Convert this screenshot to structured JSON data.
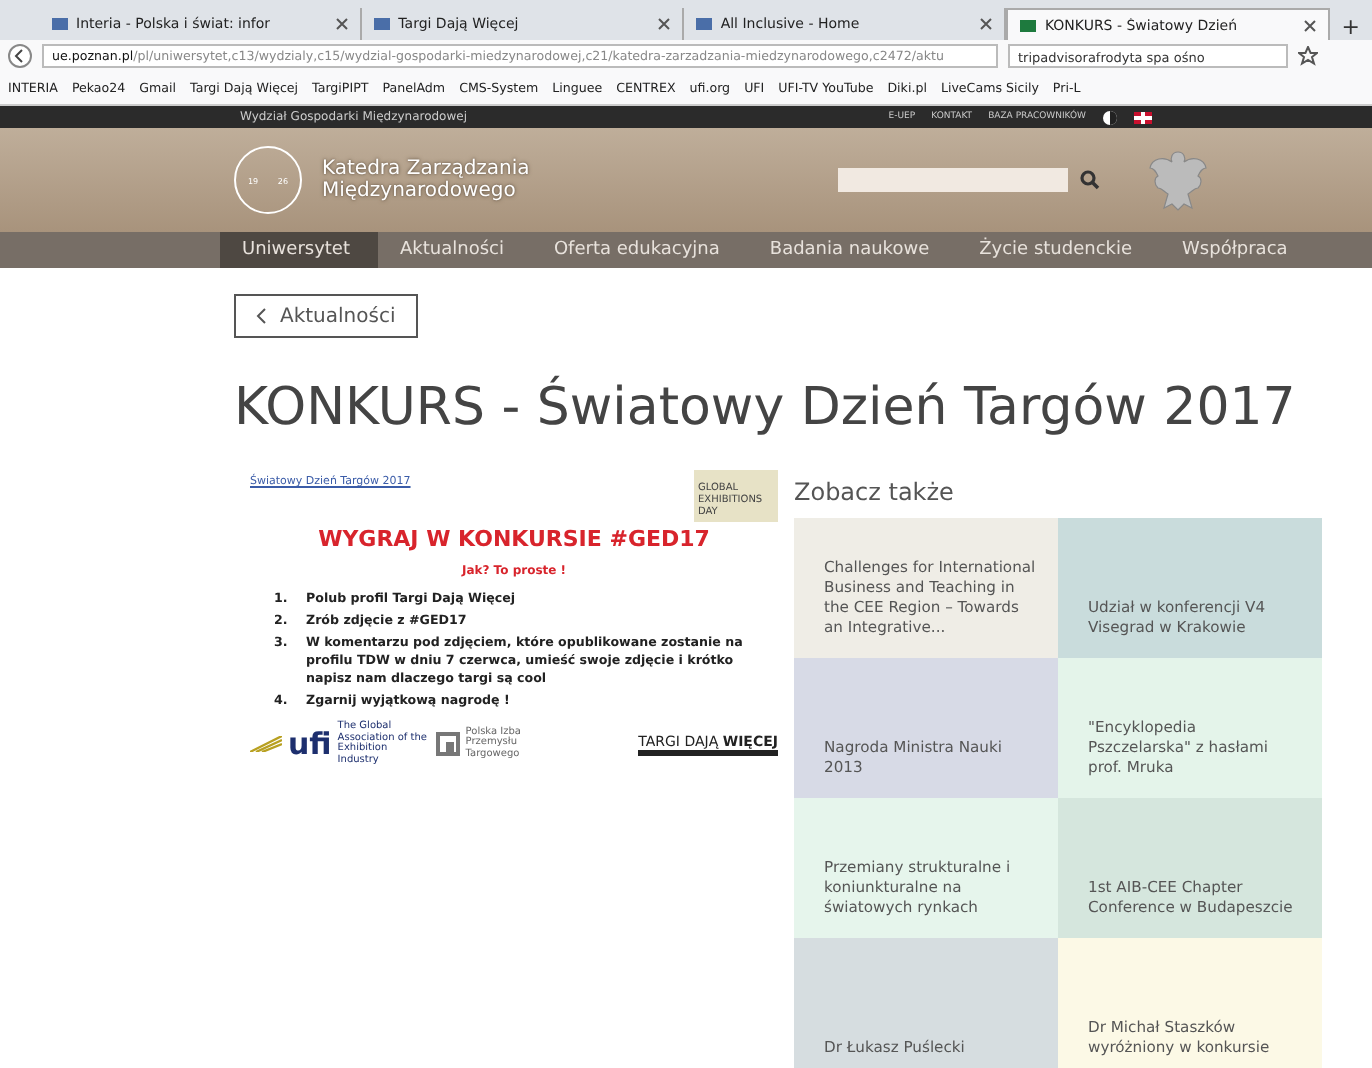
{
  "browser": {
    "tabs": [
      {
        "label": "Interia - Polska i świat: infor",
        "selected": false
      },
      {
        "label": "Targi Dają Więcej",
        "selected": false
      },
      {
        "label": "All Inclusive - Home",
        "selected": false
      },
      {
        "label": "KONKURS - Światowy Dzień",
        "selected": true
      }
    ],
    "new_tab": "+",
    "url": {
      "host": "ue.poznan.pl",
      "path": "/pl/uniwersytet,c13/wydzialy,c15/wydzial-gospodarki-miedzynarodowej,c21/katedra-zarzadzania-miedzynarodowego,c2472/aktu"
    },
    "search": {
      "value": "tripadvisorafrodyta spa ośno"
    },
    "bookmarks": [
      "INTERIA",
      "Pekao24",
      "Gmail",
      "Targi Dają Więcej",
      "TargiPIPT",
      "PanelAdm",
      "CMS-System",
      "Linguee",
      "CENTREX",
      "ufi.org",
      "UFI",
      "UFI-TV YouTube",
      "Diki.pl",
      "LiveCams Sicily",
      "Pri-L"
    ]
  },
  "topbar": {
    "faculty": "Wydział Gospodarki Międzynarodowej",
    "links": [
      "E-UEP",
      "KONTAKT",
      "BAZA PRACOWNIKÓW"
    ]
  },
  "header": {
    "title_line1": "Katedra Zarządzania",
    "title_line2": "Międzynarodowego",
    "logo_years": [
      "19",
      "26"
    ]
  },
  "nav": [
    {
      "label": "Uniwersytet",
      "selected": true
    },
    {
      "label": "Aktualności",
      "selected": false
    },
    {
      "label": "Oferta edukacyjna",
      "selected": false
    },
    {
      "label": "Badania naukowe",
      "selected": false
    },
    {
      "label": "Życie studenckie",
      "selected": false
    },
    {
      "label": "Współpraca",
      "selected": false
    }
  ],
  "back_button": "Aktualności",
  "page_title": "KONKURS - Światowy Dzień Targów 2017",
  "slide": {
    "caption": "Światowy Dzień Targów 2017",
    "badge": "GLOBAL EXHIBITIONS DAY",
    "headline": "WYGRAJ W KONKURSIE #GED17",
    "subhead": "Jak? To proste !",
    "steps": [
      {
        "number": "1.",
        "text": "Polub profil Targi Dają Więcej"
      },
      {
        "number": "2.",
        "text": "Zrób zdjęcie z #GED17"
      },
      {
        "number": "3.",
        "text": "W komentarzu pod zdjęciem, które opublikowane zostanie na profilu TDW w dniu 7 czerwca, umieść swoje zdjęcie i krótko napisz nam dlaczego targi są cool"
      },
      {
        "number": "4.",
        "text": "Zgarnij wyjątkową nagrodę !"
      }
    ],
    "ufi": "ufi",
    "ufi_tagline": "The Global Association of the Exhibition Industry",
    "pipt": "Polska Izba Przemysłu Targowego",
    "tdw": "TARGI DAJĄ **WIĘCEJ**"
  },
  "see_also": {
    "heading": "Zobacz także",
    "tiles": [
      {
        "title": "Challenges for International Business and Teaching in the CEE Region – Towards an Integrative...",
        "color": "#efede6"
      },
      {
        "title": "Udział w konferencji V4 Visegrad w Krakowie",
        "color": "#c9dcdc"
      },
      {
        "title": "Nagroda Ministra Nauki 2013",
        "color": "#d7dae6"
      },
      {
        "title": "\"Encyklopedia Pszczelarska\" z hasłami prof. Mruka",
        "color": "#e4f4ea"
      },
      {
        "title": "Przemiany strukturalne i koniunkturalne na światowych rynkach",
        "color": "#e6f5ec"
      },
      {
        "title": "1st AIB-CEE Chapter Conference w Budapeszcie",
        "color": "#d5e6dd"
      },
      {
        "title": "Dr Łukasz Puślecki",
        "color": "#d6dde0"
      },
      {
        "title": "Dr Michał Staszków wyróżniony w konkursie",
        "color": "#fcf9e6"
      }
    ]
  }
}
